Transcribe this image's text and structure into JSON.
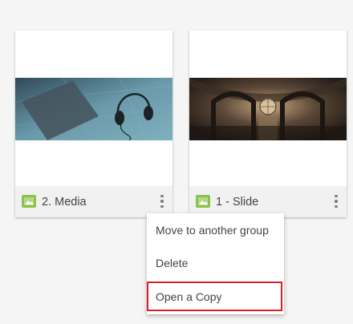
{
  "cards": [
    {
      "title": "2. Media",
      "type_icon": "image-icon",
      "thumbnail": "headphones-on-table"
    },
    {
      "title": "1 - Slide",
      "type_icon": "image-icon",
      "thumbnail": "cathedral-interior"
    }
  ],
  "context_menu": {
    "items": [
      "Move to another group",
      "Delete",
      "Open a Copy"
    ],
    "highlighted_item": "Open a Copy"
  },
  "colors": {
    "icon_green": "#8bc34a",
    "highlight_red": "#d9202a",
    "footer_bg": "#f1f1f1",
    "page_bg": "#f5f5f5"
  }
}
